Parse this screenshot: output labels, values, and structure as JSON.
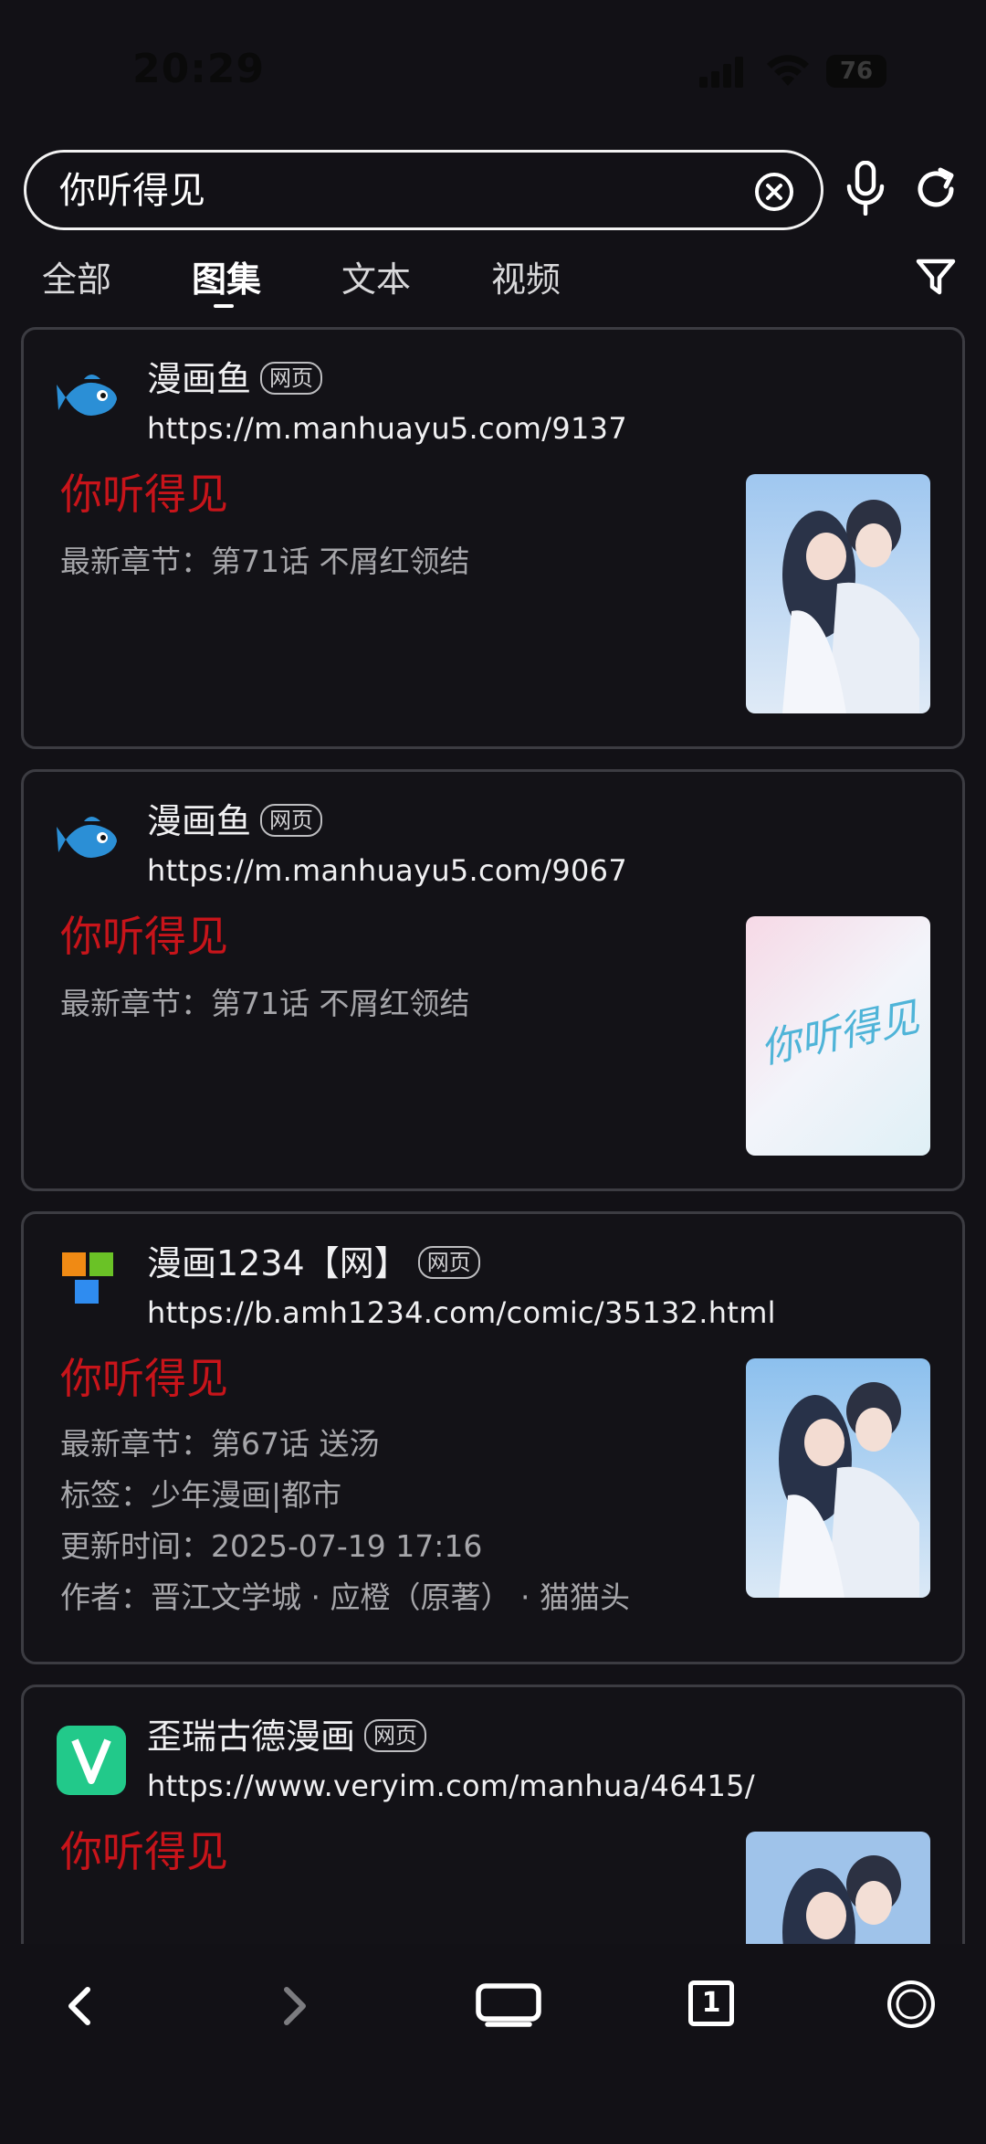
{
  "status_bar": {
    "time": "20:29",
    "battery": "76"
  },
  "search": {
    "value": "你听得见",
    "placeholder": ""
  },
  "tabs": [
    {
      "label": "全部",
      "active": false
    },
    {
      "label": "图集",
      "active": true
    },
    {
      "label": "文本",
      "active": false
    },
    {
      "label": "视频",
      "active": false
    }
  ],
  "results": [
    {
      "site": "漫画鱼",
      "badge": "网页",
      "url": "https://m.manhuayu5.com/9137",
      "title": "你听得见",
      "meta": [
        "最新章节：第71话 不屑红领结"
      ],
      "icon": "fish-icon"
    },
    {
      "site": "漫画鱼",
      "badge": "网页",
      "url": "https://m.manhuayu5.com/9067",
      "title": "你听得见",
      "meta": [
        "最新章节：第71话 不屑红领结"
      ],
      "icon": "fish-icon",
      "cover_text": "你听得见"
    },
    {
      "site": "漫画1234【网】",
      "badge": "网页",
      "url": "https://b.amh1234.com/comic/35132.html",
      "title": "你听得见",
      "meta": [
        "最新章节：第67话 送汤",
        "标签：少年漫画|都市",
        "更新时间：2025-07-19 17:16",
        "作者：晋江文学城 · 应橙（原著） · 猫猫头"
      ],
      "icon": "colored-squares-icon"
    },
    {
      "site": "歪瑞古德漫画",
      "badge": "网页",
      "url": "https://www.veryim.com/manhua/46415/",
      "title": "你听得见",
      "meta": [],
      "icon": "v-logo-icon"
    }
  ],
  "bottom_nav": {
    "tab_count": "1"
  },
  "colors": {
    "title_red": "#c8141a",
    "background": "#121116",
    "card_border": "#3c3c42"
  }
}
